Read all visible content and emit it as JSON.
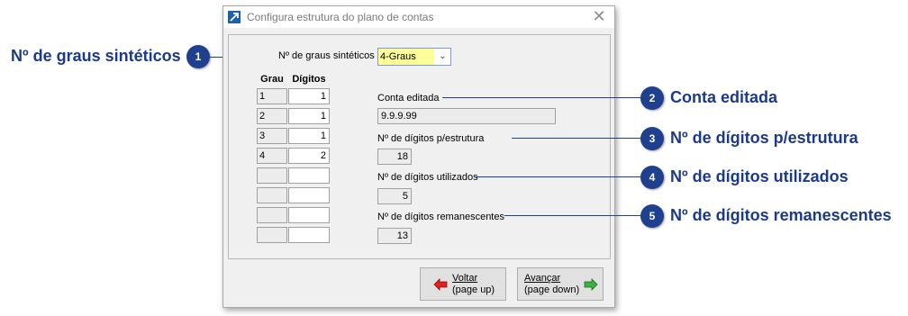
{
  "window": {
    "title": "Configura estrutura do plano de contas",
    "close_glyph": "✕"
  },
  "combo": {
    "label": "Nº de graus sintéticos",
    "value": "4-Graus",
    "arrow": "⌄"
  },
  "table": {
    "headers": [
      "Grau",
      "Dígitos"
    ],
    "rows": [
      {
        "grau": "1",
        "digitos": "1"
      },
      {
        "grau": "2",
        "digitos": "1"
      },
      {
        "grau": "3",
        "digitos": "1"
      },
      {
        "grau": "4",
        "digitos": "2"
      },
      {
        "grau": "",
        "digitos": ""
      },
      {
        "grau": "",
        "digitos": ""
      },
      {
        "grau": "",
        "digitos": ""
      },
      {
        "grau": "",
        "digitos": ""
      }
    ]
  },
  "fields": {
    "conta_label": "Conta editada",
    "conta_value": "9.9.9.99",
    "estrutura_label": "Nº de dígitos p/estrutura",
    "estrutura_value": "18",
    "utilizados_label": "Nº de dígitos utilizados",
    "utilizados_value": "5",
    "remanescentes_label": "Nº de dígitos remanescentes",
    "remanescentes_value": "13"
  },
  "buttons": {
    "voltar_line1": "Voltar",
    "voltar_line2": "(page up)",
    "avancar_line1": "Avançar",
    "avancar_line2": "(page down)",
    "voltar_arrow_color": "#e02020",
    "avancar_arrow_color": "#3cb043"
  },
  "callouts": [
    {
      "number": "1",
      "label": "Nº de graus sintéticos"
    },
    {
      "number": "2",
      "label": "Conta editada"
    },
    {
      "number": "3",
      "label": "Nº de dígitos p/estrutura"
    },
    {
      "number": "4",
      "label": "Nº de dígitos utilizados"
    },
    {
      "number": "5",
      "label": "Nº de dígitos remanescentes"
    }
  ],
  "colors": {
    "callout": "#1f3f8f",
    "combo_highlight": "#ffff99"
  }
}
